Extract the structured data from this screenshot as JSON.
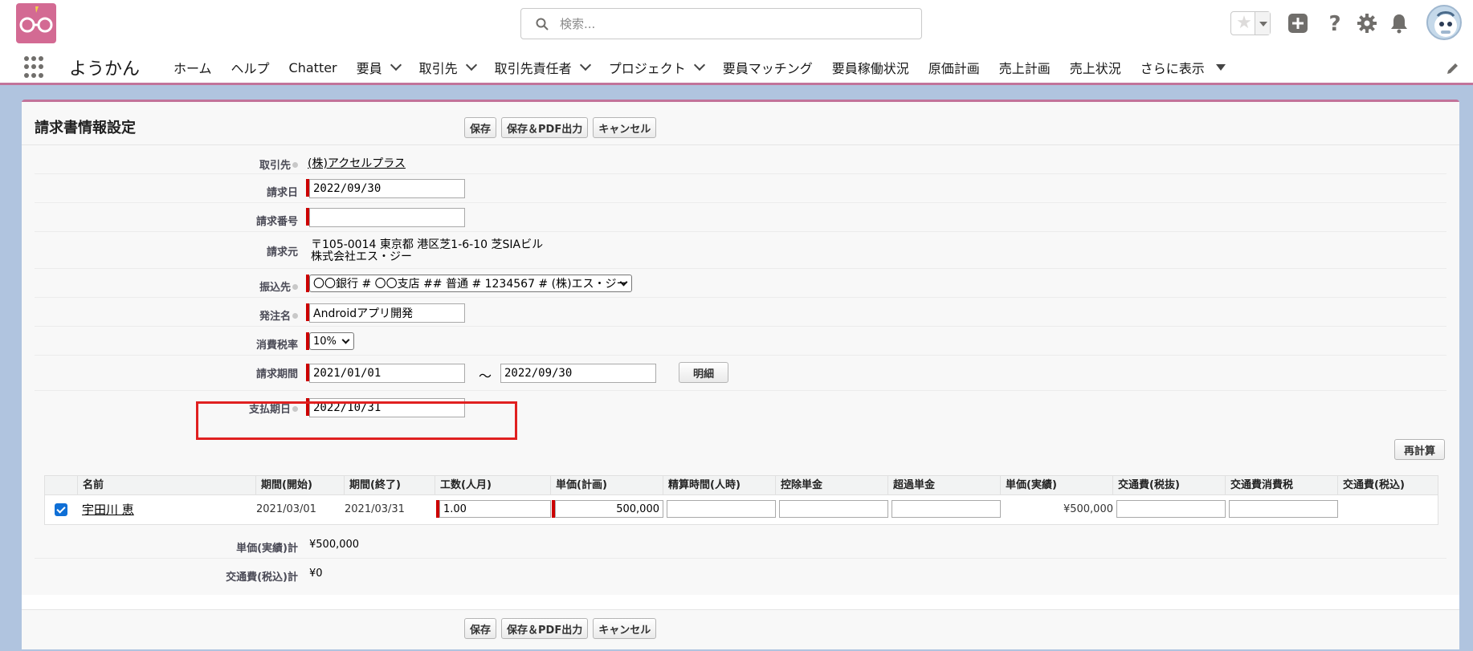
{
  "header": {
    "search_placeholder": "検索...",
    "icons": [
      "favorites-star-icon",
      "add-icon",
      "help-icon",
      "setup-gear-icon",
      "notification-bell-icon",
      "user-avatar"
    ]
  },
  "nav": {
    "app_name": "ようかん",
    "items": [
      {
        "label": "ホーム",
        "has_dropdown": false
      },
      {
        "label": "ヘルプ",
        "has_dropdown": false
      },
      {
        "label": "Chatter",
        "has_dropdown": false
      },
      {
        "label": "要員",
        "has_dropdown": true
      },
      {
        "label": "取引先",
        "has_dropdown": true
      },
      {
        "label": "取引先責任者",
        "has_dropdown": true
      },
      {
        "label": "プロジェクト",
        "has_dropdown": true
      },
      {
        "label": "要員マッチング",
        "has_dropdown": false
      },
      {
        "label": "要員稼働状況",
        "has_dropdown": false
      },
      {
        "label": "原価計画",
        "has_dropdown": false
      },
      {
        "label": "売上計画",
        "has_dropdown": false
      },
      {
        "label": "売上状況",
        "has_dropdown": false
      },
      {
        "label": "さらに表示",
        "has_dropdown": true
      }
    ]
  },
  "page": {
    "title": "請求書情報設定",
    "buttons": {
      "save": "保存",
      "save_pdf": "保存＆PDF出力",
      "cancel": "キャンセル"
    },
    "recalc_button": "再計算",
    "detail_button": "明細"
  },
  "form": {
    "account": {
      "label": "取引先",
      "value": "(株)アクセルプラス"
    },
    "invoice_date": {
      "label": "請求日",
      "value": "2022/09/30"
    },
    "invoice_number": {
      "label": "請求番号",
      "value": ""
    },
    "issuer": {
      "label": "請求元",
      "line1": "〒105-0014 東京都 港区芝1-6-10 芝SIAビル",
      "line2": "株式会社エス・ジー"
    },
    "bank": {
      "label": "振込先",
      "value": "〇〇銀行 # 〇〇支店 ## 普通 # 1234567 # (株)エス・ジー"
    },
    "order_name": {
      "label": "発注名",
      "value": "Androidアプリ開発"
    },
    "tax_rate": {
      "label": "消費税率",
      "value": "10%"
    },
    "period": {
      "label": "請求期間",
      "from": "2021/01/01",
      "separator": "～",
      "to": "2022/09/30"
    },
    "due_date": {
      "label": "支払期日",
      "value": "2022/10/31"
    }
  },
  "table": {
    "headers": [
      "名前",
      "期間(開始)",
      "期間(終了)",
      "工数(人月)",
      "単価(計画)",
      "精算時間(人時)",
      "控除単金",
      "超過単金",
      "単価(実績)",
      "交通費(税抜)",
      "交通費消費税",
      "交通費(税込)"
    ],
    "rows": [
      {
        "checked": true,
        "name": "宇田川 恵",
        "start": "2021/03/01",
        "end": "2021/03/31",
        "man_months": "1.00",
        "plan_price": "500,000",
        "hours": "",
        "deduction": "",
        "excess": "",
        "actual_price": "¥500,000",
        "transport_ex": "",
        "transport_tax": "",
        "transport_in": ""
      }
    ]
  },
  "totals": {
    "actual_total": {
      "label": "単価(実績)計",
      "value": "¥500,000"
    },
    "transport_total": {
      "label": "交通費(税込)計",
      "value": "¥0"
    }
  },
  "colors": {
    "brand": "#d36a93",
    "nav_accent": "#c2739a",
    "required": "#cc0000",
    "highlight": "#e02020",
    "checkbox": "#0f6fd6"
  }
}
